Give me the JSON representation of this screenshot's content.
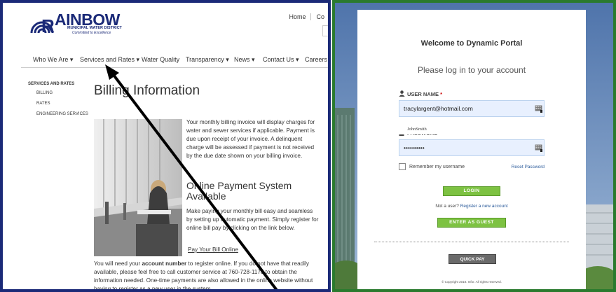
{
  "left": {
    "logo": {
      "word": "AINBOW",
      "sub1": "MUNICIPAL WATER DISTRICT",
      "sub2": "Committed to Excellence"
    },
    "toplinks": [
      "Home",
      "Co"
    ],
    "nav": [
      "Who We Are ▾",
      "Services and Rates ▾",
      "Water Quality",
      "Transparency ▾",
      "News ▾",
      "Contact Us ▾",
      "Careers"
    ],
    "sidenav": {
      "heading": "SERVICES AND RATES",
      "items": [
        "BILLING",
        "RATES",
        "ENGINEERING SERVICES"
      ]
    },
    "title": "Billing Information",
    "billing_paragraph": "Your monthly billing invoice will display charges for water and sewer services if applicable. Payment is due upon receipt of your invoice.  A delinquent charge will be assessed if payment is not received by the due date shown on your billing invoice.",
    "online_title": "Online Payment System Available",
    "online_paragraph": "Make paying your monthly bill easy and seamless by setting up automatic payment. Simply register for online bill pay by clicking on the link below.",
    "pay_link": "Pay Your Bill Online",
    "account_text_before": "You will need your ",
    "account_text_bold": "account number",
    "account_text_after": " to register online. If you do not have that readily available, please feel free to call customer service at 760-728-1178 to obtain the information needed.  One-time payments are also allowed in the online website without having to register as a new user in the system."
  },
  "right": {
    "welcome": "Welcome to Dynamic Portal",
    "subtitle": "Please log in to your account",
    "username_label": "USER NAME",
    "username_value": "tracylargent@hotmail.com",
    "suggestion": "JohnSmith",
    "password_label": "PASSWORD",
    "password_value": "••••••••••",
    "required_mark": "*",
    "remember": "Remember my username",
    "reset": "Reset Password",
    "login": "LOGIN",
    "not_user": "Not a user?",
    "register": "Register a new account",
    "guest": "ENTER AS GUEST",
    "quickpay": "QUICK PAY",
    "copyright": "© Copyright 2018. Infor. All rights reserved."
  },
  "colors": {
    "left_border": "#1b2a78",
    "right_border": "#2a7a2e",
    "brand_blue": "#1b2a78",
    "button_green": "#7dc242"
  },
  "icons": [
    "rainbow-logo-icon",
    "user-icon",
    "lock-icon",
    "keyboard-icon",
    "annotation-arrow"
  ]
}
